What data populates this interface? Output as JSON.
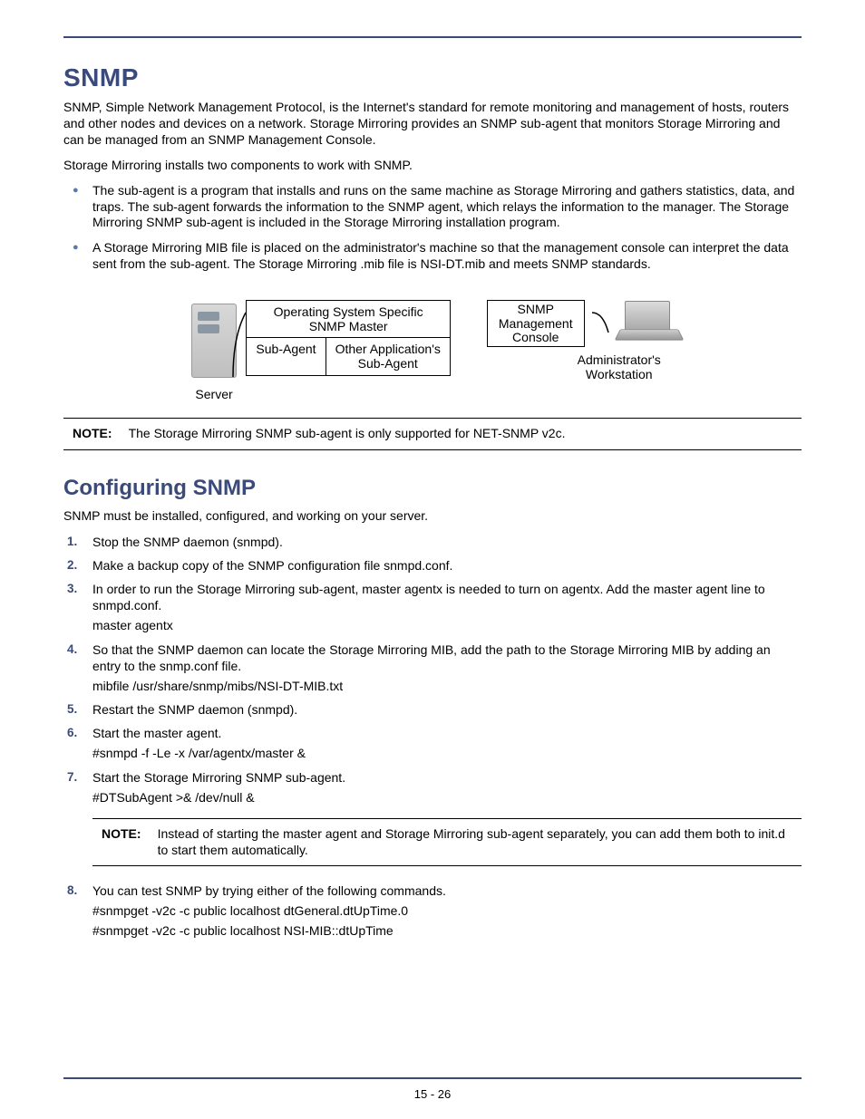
{
  "title1": "SNMP",
  "intro": "SNMP, Simple Network Management Protocol, is the Internet's standard for remote monitoring and management of hosts, routers and other nodes and devices on a network. Storage Mirroring provides an SNMP sub-agent that monitors Storage Mirroring and can be managed from an SNMP Management Console.",
  "intro2": "Storage Mirroring installs two components to work with SNMP.",
  "bullets": [
    "The sub-agent is a program that installs and runs on the same machine as Storage Mirroring and gathers statistics, data, and traps. The sub-agent forwards the information to the SNMP agent, which relays the information to the manager. The Storage Mirroring SNMP sub-agent is included in the Storage Mirroring installation program.",
    "A Storage Mirroring MIB file is placed on the administrator's machine so that the management console can interpret the data sent from the sub-agent. The Storage Mirroring .mib file is NSI-DT.mib and meets SNMP standards."
  ],
  "diagram": {
    "server_label": "Server",
    "os_master": "Operating System Specific\nSNMP Master",
    "sub_agent": "Sub-Agent",
    "other_sub": "Other Application's\nSub-Agent",
    "console": "SNMP\nManagement\nConsole",
    "workstation": "Administrator's\nWorkstation"
  },
  "note1_label": "NOTE:",
  "note1_body": "The Storage Mirroring SNMP sub-agent is only supported for NET-SNMP v2c.",
  "title2": "Configuring SNMP",
  "config_intro": "SNMP must be installed, configured, and working on your server.",
  "steps": [
    {
      "text": "Stop the SNMP daemon (snmpd)."
    },
    {
      "text": "Make a backup copy of the SNMP configuration file snmpd.conf."
    },
    {
      "text": "In order to run the Storage Mirroring sub-agent, master agentx is needed to turn on agentx. Add the master agent  line to snmpd.conf.",
      "sub": "master agentx"
    },
    {
      "text": "So that the SNMP daemon can locate the Storage Mirroring MIB, add the path to the Storage Mirroring MIB by adding an entry to the snmp.conf file.",
      "sub": "mibfile /usr/share/snmp/mibs/NSI-DT-MIB.txt"
    },
    {
      "text": "Restart the SNMP daemon (snmpd)."
    },
    {
      "text": "Start the master agent.",
      "sub": "#snmpd -f -Le -x /var/agentx/master &"
    },
    {
      "text": "Start the Storage Mirroring SNMP sub-agent.",
      "sub": "#DTSubAgent >& /dev/null &"
    }
  ],
  "note2_label": "NOTE:",
  "note2_body": "Instead of starting the master agent and Storage Mirroring sub-agent separately, you can add them both to init.d to start them automatically.",
  "step8": {
    "text": "You can test SNMP by trying either of the following commands.",
    "sub1": "#snmpget -v2c -c public localhost dtGeneral.dtUpTime.0",
    "sub2": "#snmpget -v2c -c public localhost NSI-MIB::dtUpTime"
  },
  "page_number": "15 - 26"
}
